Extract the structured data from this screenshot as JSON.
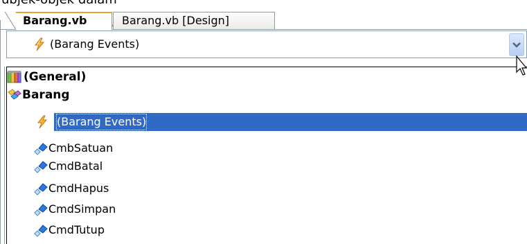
{
  "page": {
    "clipped_text": "ubjek-objek dalam"
  },
  "tabs": [
    {
      "label": "Barang.vb",
      "active": true
    },
    {
      "label": "Barang.vb [Design]",
      "active": false
    }
  ],
  "combo": {
    "selected_label": "(Barang Events)",
    "icon": "events-lightning-icon",
    "button_icon": "chevron-down-icon"
  },
  "dropdown": {
    "items": [
      {
        "label": "(General)",
        "icon": "general-module-icon",
        "bold": true,
        "selected": false
      },
      {
        "label": "Barang",
        "icon": "class-icon",
        "bold": true,
        "selected": false
      },
      {
        "label": "(Barang Events)",
        "icon": "events-lightning-icon",
        "bold": false,
        "selected": true
      },
      {
        "label": "CmbSatuan",
        "icon": "field-icon",
        "bold": false,
        "selected": false
      },
      {
        "label": "CmdBatal",
        "icon": "field-icon",
        "bold": false,
        "selected": false
      },
      {
        "label": "CmdHapus",
        "icon": "field-icon",
        "bold": false,
        "selected": false
      },
      {
        "label": "CmdSimpan",
        "icon": "field-icon",
        "bold": false,
        "selected": false
      },
      {
        "label": "CmdTutup",
        "icon": "field-icon",
        "bold": false,
        "selected": false
      }
    ]
  },
  "colors": {
    "selection_background": "#316ac5",
    "tab_border": "#919b9c",
    "active_tab_accent": "#e5a42a",
    "combo_border": "#7f9db9"
  }
}
